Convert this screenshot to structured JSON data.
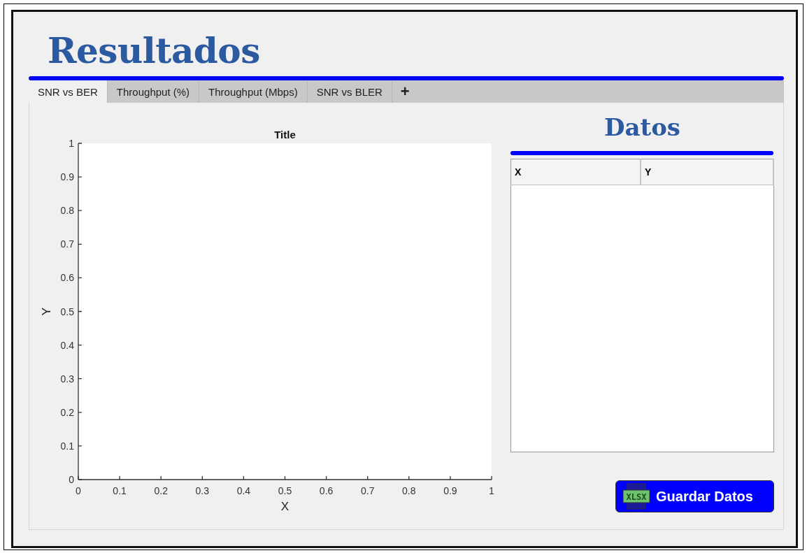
{
  "header": {
    "title": "Resultados"
  },
  "tabs": [
    {
      "label": "SNR vs BER",
      "selected": true
    },
    {
      "label": "Throughput (%)",
      "selected": false
    },
    {
      "label": "Throughput (Mbps)",
      "selected": false
    },
    {
      "label": "SNR vs BLER",
      "selected": false
    }
  ],
  "add_tab": {
    "label": "+"
  },
  "chart": {
    "chart_data": {
      "type": "line",
      "title": "Title",
      "xlabel": "X",
      "ylabel": "Y",
      "xlim": [
        0,
        1
      ],
      "ylim": [
        0,
        1
      ],
      "xticks": [
        0,
        0.1,
        0.2,
        0.3,
        0.4,
        0.5,
        0.6,
        0.7,
        0.8,
        0.9,
        1
      ],
      "yticks": [
        0,
        0.1,
        0.2,
        0.3,
        0.4,
        0.5,
        0.6,
        0.7,
        0.8,
        0.9,
        1
      ]
    }
  },
  "data_panel": {
    "title": "Datos",
    "table": {
      "columns": [
        "X",
        "Y"
      ]
    },
    "save_button": {
      "label": "Guardar Datos",
      "icon_text": "XLSX"
    }
  }
}
